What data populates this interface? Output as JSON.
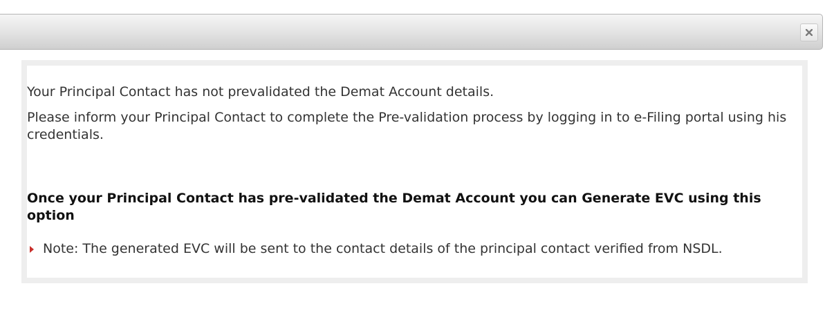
{
  "dialog": {
    "close_icon": "close-icon",
    "messages": {
      "line1": "Your Principal Contact has not prevalidated the Demat Account details.",
      "line2": "Please inform your Principal Contact to complete the Pre-validation process by logging in to e-Filing portal using his credentials.",
      "bold_heading": "Once your Principal Contact has pre-validated the Demat Account you can Generate EVC using this option",
      "note": "Note: The generated EVC will be sent to the contact details of the principal contact verified from NSDL."
    },
    "colors": {
      "note_arrow": "#c9302c",
      "text": "#333333"
    }
  }
}
